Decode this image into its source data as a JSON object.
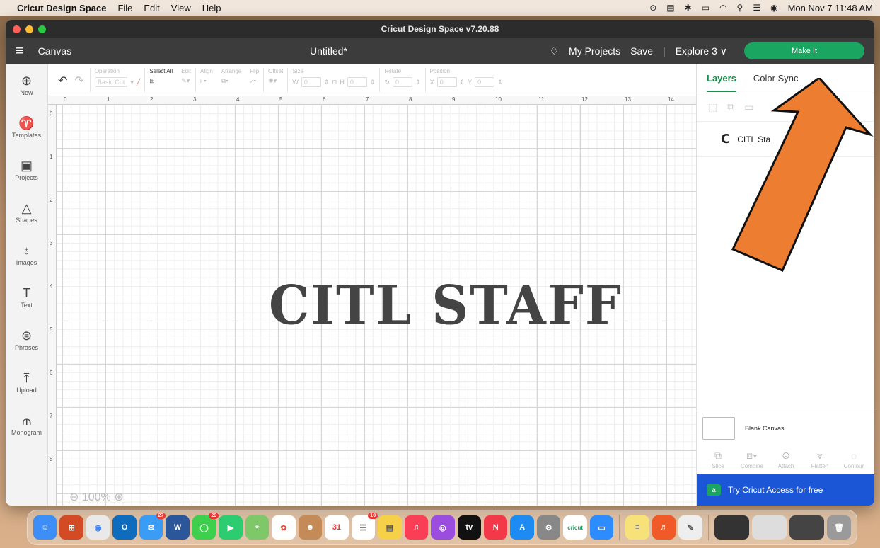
{
  "menubar": {
    "app": "Cricut Design Space",
    "items": [
      "File",
      "Edit",
      "View",
      "Help"
    ],
    "datetime": "Mon Nov 7  11:48 AM"
  },
  "window": {
    "title": "Cricut Design Space  v7.20.88"
  },
  "appbar": {
    "section": "Canvas",
    "doc_title": "Untitled*",
    "my_projects": "My Projects",
    "save": "Save",
    "separator": "|",
    "machine": "Explore 3 ∨",
    "make_it": "Make It"
  },
  "leftnav": [
    {
      "label": "New",
      "icon": "plus-circle-icon"
    },
    {
      "label": "Templates",
      "icon": "shirt-icon"
    },
    {
      "label": "Projects",
      "icon": "clipboard-icon"
    },
    {
      "label": "Shapes",
      "icon": "shapes-icon"
    },
    {
      "label": "Images",
      "icon": "bulb-icon"
    },
    {
      "label": "Text",
      "icon": "text-icon"
    },
    {
      "label": "Phrases",
      "icon": "chat-icon"
    },
    {
      "label": "Upload",
      "icon": "upload-icon"
    },
    {
      "label": "Monogram",
      "icon": "monogram-icon"
    }
  ],
  "toolbar": {
    "operation_label": "Operation",
    "operation_value": "Basic Cut",
    "select_all": "Select All",
    "edit": "Edit",
    "align": "Align",
    "arrange": "Arrange",
    "flip": "Flip",
    "offset": "Offset",
    "size": "Size",
    "w": "W",
    "h": "H",
    "rotate": "Rotate",
    "position": "Position",
    "x": "X",
    "y": "Y"
  },
  "ruler": {
    "h": [
      "0",
      "1",
      "2",
      "3",
      "4",
      "5",
      "6",
      "7",
      "8",
      "9",
      "10",
      "11",
      "12",
      "13",
      "14"
    ],
    "v": [
      "0",
      "1",
      "2",
      "3",
      "4",
      "5",
      "6",
      "7",
      "8"
    ]
  },
  "canvas": {
    "text": "CITL STAFF",
    "zoom": "100%"
  },
  "panel": {
    "tab_layers": "Layers",
    "tab_color_sync": "Color Sync",
    "layer_glyph": "C",
    "layer_name": "CITL Sta",
    "blank_canvas": "Blank Canvas",
    "tools": [
      "Slice",
      "Combine",
      "Attach",
      "Flatten",
      "Contour"
    ],
    "access_icon": "a",
    "access": "Try Cricut Access for free"
  },
  "dock": {
    "badges": {
      "mail": "27",
      "messages": "29",
      "reminders": "10"
    },
    "cricut_label": "cricut",
    "calendar_day": "31",
    "tv_label": "tv"
  },
  "colors": {
    "accent": "#1aa560",
    "access_blue": "#1a56d6",
    "arrow": "#ed7d31"
  }
}
